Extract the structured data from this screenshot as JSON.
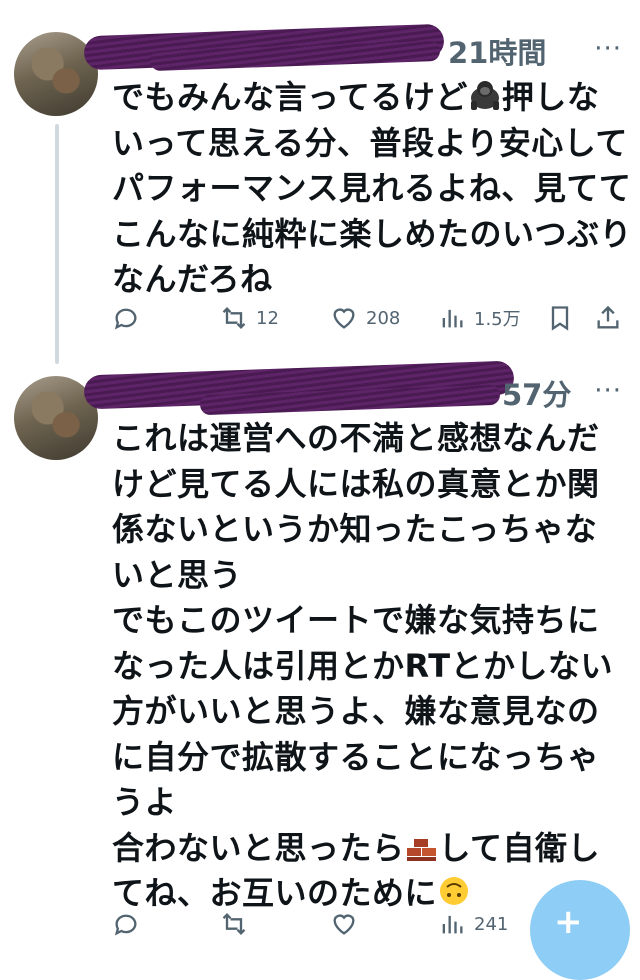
{
  "tweets": [
    {
      "time": "21時間",
      "more": "···",
      "lines": [
        "でもみんな言ってるけど",
        "押しな",
        "いって思える分、普段より安心して",
        "パフォーマンス見れるよね、見てて",
        "こんなに純粋に楽しめたのいつぶり",
        "なんだろね"
      ],
      "emoji": "gorilla-emoji",
      "replies": "",
      "retweets": "12",
      "likes": "208",
      "views": "1.5万"
    },
    {
      "time": "57分",
      "more": "···",
      "lines": [
        "これは運営への不満と感想なんだ",
        "けど見てる人には私の真意とか関",
        "係ないというか知ったこっちゃな",
        "いと思う",
        "でもこのツイートで嫌な気持ちに",
        "なった人は引用とかRTとかしない",
        "方がいいと思うよ、嫌な意見なの",
        "に自分で拡散することになっちゃ",
        "うよ",
        "合わないと思ったら",
        "して自衛し",
        "てね、お互いのために"
      ],
      "emoji_brick": "brick-emoji",
      "emoji_face": "upside-down-face-emoji",
      "replies": "",
      "retweets": "",
      "likes": "",
      "views": "241"
    }
  ],
  "fab_label": "+",
  "colors": {
    "text": "#0f1419",
    "meta": "#536471",
    "fab": "#8ecdf6",
    "redaction": "#4a1a52"
  }
}
